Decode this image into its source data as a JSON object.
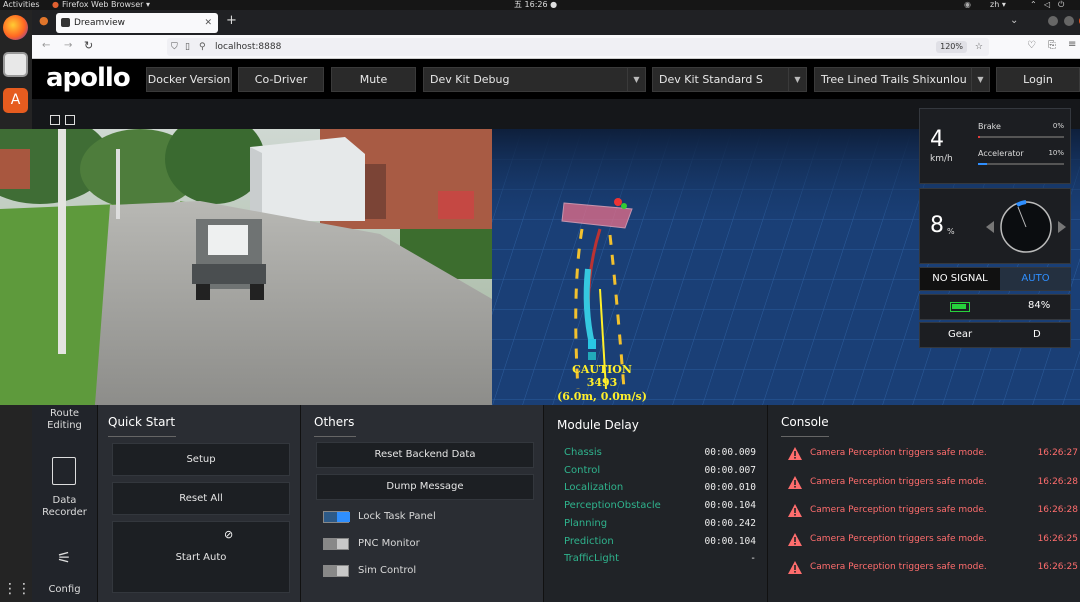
{
  "os": {
    "activities": "Activities",
    "app_menu": "Firefox Web Browser ▾",
    "clock": "五 16:26 ●",
    "lang": "zh ▾"
  },
  "browser": {
    "tab_title": "Dreamview",
    "url": "localhost:8888",
    "zoom": "120%"
  },
  "header": {
    "logo": "apollo",
    "docker_version": "Docker Version",
    "co_driver": "Co-Driver",
    "mute": "Mute",
    "mode": "Dev Kit Debug",
    "vehicle": "Dev Kit Standard S",
    "map": "Tree Lined Trails Shixunlou",
    "login": "Login"
  },
  "scene": {
    "caution": "CAUTION",
    "obstacle_id": "3493",
    "obstacle_info": "(6.0m, 0.0m/s)"
  },
  "status": {
    "speed_value": "4",
    "speed_unit": "km/h",
    "brake_label": "Brake",
    "brake_pct": "0%",
    "brake_level": 0.02,
    "accel_label": "Accelerator",
    "accel_pct": "10%",
    "accel_level": 0.1,
    "steer_value": "8",
    "steer_unit": "%",
    "signal": "NO SIGNAL",
    "drive_mode": "AUTO",
    "battery_pct": "84%",
    "gear_label": "Gear",
    "gear_value": "D"
  },
  "sidenav": {
    "route_editing": "Route Editing",
    "data_recorder": "Data Recorder",
    "config": "Config"
  },
  "quick_start": {
    "title": "Quick Start",
    "setup": "Setup",
    "reset_all": "Reset All",
    "start_auto": "Start Auto"
  },
  "others": {
    "title": "Others",
    "reset_backend": "Reset Backend Data",
    "dump_message": "Dump Message",
    "toggles": [
      {
        "label": "Lock Task Panel",
        "on": true
      },
      {
        "label": "PNC Monitor",
        "on": false
      },
      {
        "label": "Sim Control",
        "on": false
      }
    ]
  },
  "module_delay": {
    "title": "Module Delay",
    "rows": [
      {
        "name": "Chassis",
        "value": "00:00.009"
      },
      {
        "name": "Control",
        "value": "00:00.007"
      },
      {
        "name": "Localization",
        "value": "00:00.010"
      },
      {
        "name": "PerceptionObstacle",
        "value": "00:00.104"
      },
      {
        "name": "Planning",
        "value": "00:00.242"
      },
      {
        "name": "Prediction",
        "value": "00:00.104"
      },
      {
        "name": "TrafficLight",
        "value": "-"
      }
    ]
  },
  "console": {
    "title": "Console",
    "rows": [
      {
        "msg": "Camera Perception triggers safe mode.",
        "time": "16:26:27"
      },
      {
        "msg": "Camera Perception triggers safe mode.",
        "time": "16:26:28"
      },
      {
        "msg": "Camera Perception triggers safe mode.",
        "time": "16:26:28"
      },
      {
        "msg": "Camera Perception triggers safe mode.",
        "time": "16:26:25"
      },
      {
        "msg": "Camera Perception triggers safe mode.",
        "time": "16:26:25"
      }
    ]
  },
  "colors": {
    "accent_blue": "#2f8fff",
    "delay_green": "#2fb38d",
    "error_red": "#ff6d6d",
    "battery_green": "#27d13c"
  }
}
